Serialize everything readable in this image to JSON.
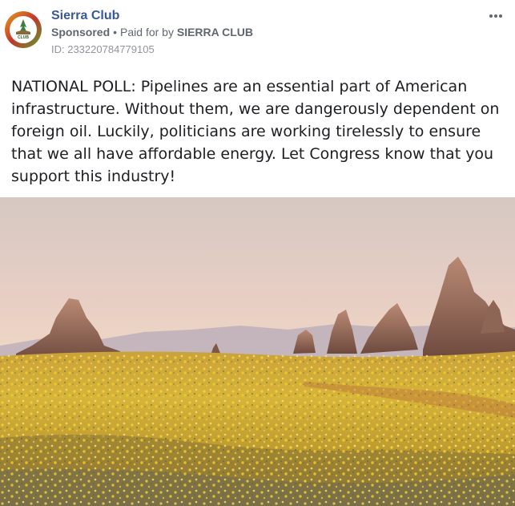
{
  "header": {
    "page_name": "Sierra Club",
    "sponsored_label": "Sponsored",
    "separator": "•",
    "paid_for_prefix": "Paid for by",
    "paid_for_name": "SIERRA CLUB",
    "ad_id": "ID: 233220784779105"
  },
  "post": {
    "text": "NATIONAL POLL: Pipelines are an essential part of American infrastructure. Without them, we are dangerously dependent on foreign oil. Luckily, politicians are working tirelessly to ensure that we all have affordable energy. Let Congress know that you support this industry!"
  },
  "icons": {
    "more": "more-options-icon",
    "avatar": "sierra-club-logo"
  },
  "colors": {
    "page_name": "#385898",
    "meta": "#606770"
  }
}
